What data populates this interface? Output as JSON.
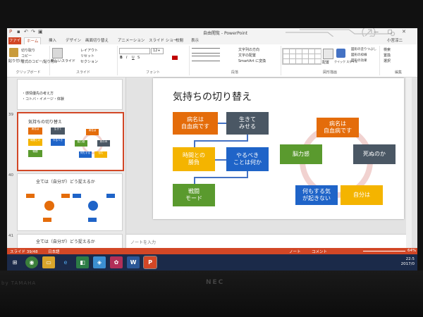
{
  "window": {
    "title": "自由閲覧 - PowerPoint",
    "min": "—",
    "max": "□",
    "close": "✕",
    "user": "小宮淳二"
  },
  "tabs": [
    "ファイル",
    "ホーム",
    "挿入",
    "デザイン",
    "画面切り替え",
    "アニメーション",
    "スライド ショー",
    "校閲",
    "表示"
  ],
  "ribbon": {
    "clipboard": {
      "label": "クリップボード",
      "paste": "貼り付け",
      "cut": "切り取り",
      "copy": "コピー",
      "format": "書式のコピー/貼り付け"
    },
    "slides": {
      "label": "スライド",
      "new": "新しいスライド",
      "layout": "レイアウト",
      "reset": "リセット",
      "section": "セクション"
    },
    "font": {
      "label": "フォント",
      "size": "12+",
      "bold": "B",
      "italic": "I",
      "underline": "U",
      "shadow": "S"
    },
    "paragraph": {
      "label": "段落",
      "direction": "文字列の方向",
      "align": "文字の配置",
      "smartart": "SmartArt に変換"
    },
    "drawing": {
      "label": "図形描画",
      "arrange": "配置",
      "styles": "クイック スタイル",
      "fill": "図形の塗りつぶし",
      "outline": "図形の枠線",
      "effects": "図形の効果"
    },
    "editing": {
      "label": "編集",
      "find": "検索",
      "replace": "置換",
      "select": "選択"
    }
  },
  "thumbnails": {
    "top_lines": [
      "・感情優先の考え方",
      "・コトバ・イメージ・体験"
    ],
    "slide39": {
      "num": "39",
      "title": "気持ちの切り替え",
      "boxes": [
        "病名は",
        "生きて",
        "時間との",
        "やるべき",
        "戦闘",
        "病名は",
        "脳力感",
        "死のみ",
        "何もする",
        "包む"
      ]
    },
    "slide40": {
      "num": "40",
      "title": "全ては（自分が）どう捉えるか"
    },
    "slide41": {
      "num": "41",
      "title": "全ては（自分が）どう捉えるか"
    }
  },
  "slide": {
    "title": "気持ちの切り替え",
    "left_flow": [
      {
        "line1": "病名は",
        "line2": "自血病です",
        "color": "#e46c0a"
      },
      {
        "line1": "生きて",
        "line2": "みせる",
        "color": "#4a5764"
      },
      {
        "line1": "時間との",
        "line2": "勝負",
        "color": "#f4b400"
      },
      {
        "line1": "やるべき",
        "line2": "ことは何か",
        "color": "#1f64c8"
      },
      {
        "line1": "戦闘",
        "line2": "モード",
        "color": "#5a9a2e"
      }
    ],
    "cycle": [
      {
        "line1": "病名は",
        "line2": "自血病です",
        "color": "#e46c0a"
      },
      {
        "line1": "死ぬのか",
        "line2": "",
        "color": "#4a5764"
      },
      {
        "line1": "自分は",
        "line2": "",
        "color": "#f4b400"
      },
      {
        "line1": "何もする気",
        "line2": "が起きない",
        "color": "#1f64c8"
      },
      {
        "line1": "脳力感",
        "line2": "",
        "color": "#5a9a2e"
      }
    ]
  },
  "notes_placeholder": "ノートを入力",
  "status": {
    "slide": "スライド 39/48",
    "lang": "日本語",
    "notes": "ノート",
    "comments": "コメント",
    "zoom": "64%"
  },
  "taskbar": {
    "icons": [
      "start",
      "chrome",
      "explorer",
      "ie",
      "store",
      "maps",
      "photos",
      "word",
      "powerpoint"
    ],
    "time": "22:5",
    "date": "2017/0"
  },
  "brand": {
    "left": "by TAMAHA",
    "center": "NEC"
  }
}
